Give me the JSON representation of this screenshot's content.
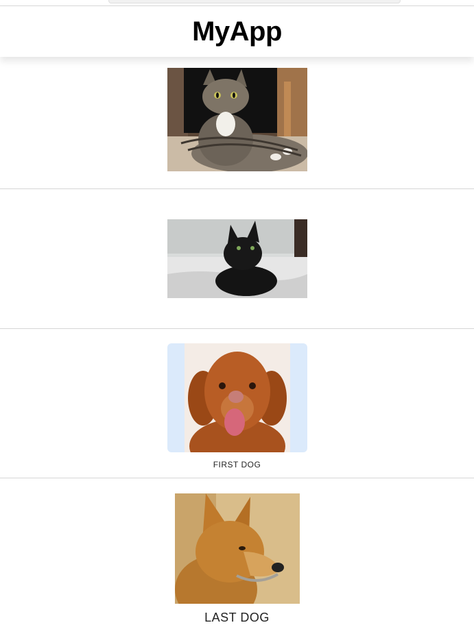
{
  "app": {
    "title": "MyApp"
  },
  "items": [
    {
      "caption": ""
    },
    {
      "caption": ""
    },
    {
      "caption": "FIRST DOG"
    },
    {
      "caption": "LAST DOG"
    }
  ]
}
